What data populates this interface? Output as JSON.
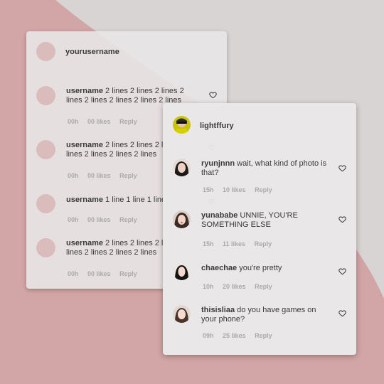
{
  "colors": {
    "background": "#d8d4d3",
    "accent_blob": "#d2a5a6",
    "card": "#e9e7e7",
    "placeholder_avatar": "#dbbcbd"
  },
  "back_card": {
    "header_username": "yourusername",
    "comments": [
      {
        "username": "username",
        "text": "2 lines 2 lines 2 lines 2 lines 2 lines 2 lines 2 lines 2 lines",
        "time": "00h",
        "likes": "00 likes",
        "reply": "Reply"
      },
      {
        "username": "username",
        "text": "2 lines 2 lines 2 lines 2 lines 2 lines 2 lines 2 lines",
        "time": "00h",
        "likes": "00 likes",
        "reply": "Reply"
      },
      {
        "username": "username",
        "text": "1 line 1 line 1 line 1 line",
        "time": "00h",
        "likes": "00 likes",
        "reply": "Reply"
      },
      {
        "username": "username",
        "text": "2 lines 2 lines 2 lines 2 lines 2 lines 2 lines 2 lines",
        "time": "00h",
        "likes": "00 likes",
        "reply": "Reply"
      }
    ]
  },
  "front_card": {
    "header_username": "lightffury",
    "comments": [
      {
        "username": "ryunjnnn",
        "text": "wait, what kind of photo is that?",
        "time": "15h",
        "likes": "10 likes",
        "reply": "Reply"
      },
      {
        "username": "yunababe",
        "text": "UNNIE, YOU'RE SOMETHING ELSE",
        "time": "15h",
        "likes": "11 likes",
        "reply": "Reply"
      },
      {
        "username": "chaechae",
        "text": "you're pretty",
        "time": "10h",
        "likes": "20 likes",
        "reply": "Reply"
      },
      {
        "username": "thisisliaa",
        "text": "do you have games on your phone?",
        "time": "09h",
        "likes": "25 likes",
        "reply": "Reply"
      }
    ]
  }
}
